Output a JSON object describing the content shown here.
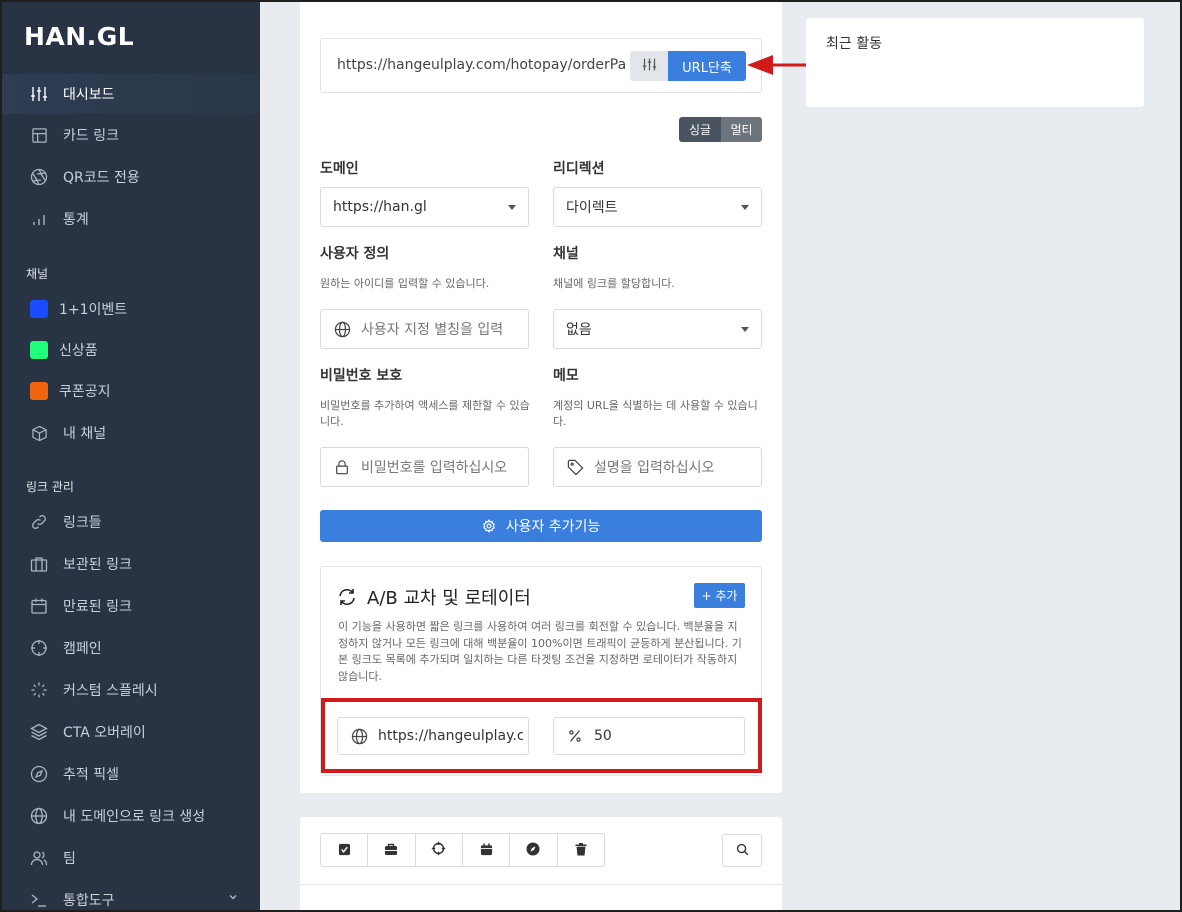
{
  "brand": {
    "logo": "HAN.GL"
  },
  "sidebar": {
    "main_items": [
      {
        "label": "대시보드",
        "icon": "sliders-icon",
        "active": true
      },
      {
        "label": "카드 링크",
        "icon": "layout-icon"
      },
      {
        "label": "QR코드 전용",
        "icon": "aperture-icon"
      },
      {
        "label": "통계",
        "icon": "bar-chart-icon"
      }
    ],
    "channels_label": "채널",
    "channels": [
      {
        "label": "1+1이벤트",
        "color": "#1a4cff"
      },
      {
        "label": "신상품",
        "color": "#1fff7a"
      },
      {
        "label": "쿠폰공지",
        "color": "#f0650e"
      },
      {
        "label": "내 채널",
        "icon": "box-icon"
      }
    ],
    "links_label": "링크 관리",
    "link_items": [
      {
        "label": "링크들",
        "icon": "link-icon"
      },
      {
        "label": "보관된 링크",
        "icon": "briefcase-icon"
      },
      {
        "label": "만료된 링크",
        "icon": "calendar-icon"
      },
      {
        "label": "캠페인",
        "icon": "crosshair-icon"
      },
      {
        "label": "커스텀 스플레시",
        "icon": "loader-icon"
      },
      {
        "label": "CTA 오버레이",
        "icon": "layers-icon"
      },
      {
        "label": "추적 픽셀",
        "icon": "compass-icon"
      },
      {
        "label": "내 도메인으로 링크 생성",
        "icon": "globe-icon"
      },
      {
        "label": "팀",
        "icon": "users-icon"
      },
      {
        "label": "통합도구",
        "icon": "terminal-icon"
      }
    ]
  },
  "shortener": {
    "url_value": "https://hangeulplay.com/hotopay/orderPag",
    "shorten_label": "URL단축",
    "mode_single": "싱글",
    "mode_multi": "멀티"
  },
  "form": {
    "domain_label": "도메인",
    "domain_value": "https://han.gl",
    "redirect_label": "리디렉션",
    "redirect_value": "다이렉트",
    "custom_label": "사용자 정의",
    "custom_help": "원하는 아이디를 입력할 수 있습니다.",
    "custom_placeholder": "사용자 지정 별칭을 입력",
    "channel_label": "채널",
    "channel_help": "채널에 링크를 할당합니다.",
    "channel_value": "없음",
    "password_label": "비밀번호 보호",
    "password_help": "비밀번호를 추가하여 액세스를 제한할 수 있습니다.",
    "password_placeholder": "비밀번호를 입력하십시오",
    "memo_label": "메모",
    "memo_help": "계정의 URL을 식별하는 데 사용할 수 있습니다.",
    "memo_placeholder": "설명을 입력하십시오",
    "advanced_label": "사용자 추가기능"
  },
  "ab": {
    "title": "A/B 교차 및 로테이터",
    "add_label": "+ 추가",
    "description": "이 기능을 사용하면 짧은 링크를 사용하여 여러 링크를 회전할 수 있습니다. 백분율을 지정하지 않거나 모든 링크에 대해 백분율이 100%이면 트래픽이 균등하게 분산됩니다. 기본 링크도 목록에 추가되며 일치하는 다른 타겟팅 조건을 지정하면 로테이터가 작동하지 않습니다.",
    "row_url": "https://hangeulplay.co",
    "row_percent": "50"
  },
  "recent": {
    "title": "최근 활동"
  },
  "colors": {
    "accent": "#3a7fde",
    "sidebar": "#283444",
    "highlight": "#d11a1a"
  }
}
